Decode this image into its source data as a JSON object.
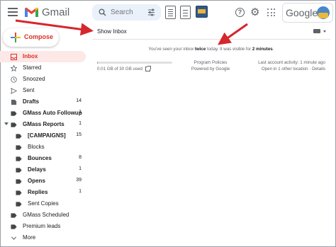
{
  "header": {
    "app_name": "Gmail",
    "search_placeholder": "Search",
    "account_brand": "Google",
    "icons": [
      "menu-icon",
      "gmail-logo",
      "search-icon",
      "filter-icon",
      "extension-icon",
      "extension-icon",
      "extension-icon",
      "help-icon",
      "gear-icon",
      "apps-icon",
      "avatar"
    ]
  },
  "compose": {
    "label": "Compose"
  },
  "sidebar": {
    "items": [
      {
        "label": "Inbox",
        "count": "",
        "icon": "inbox-icon",
        "active": true
      },
      {
        "label": "Starred",
        "count": "",
        "icon": "star-icon"
      },
      {
        "label": "Snoozed",
        "count": "",
        "icon": "clock-icon"
      },
      {
        "label": "Sent",
        "count": "",
        "icon": "send-icon"
      },
      {
        "label": "Drafts",
        "count": "14",
        "icon": "draft-icon"
      },
      {
        "label": "GMass Auto Followup",
        "count": "1",
        "icon": "label-icon"
      },
      {
        "label": "GMass Reports",
        "count": "1",
        "icon": "label-icon",
        "expanded": true
      },
      {
        "label": "[CAMPAIGNS]",
        "count": "15",
        "icon": "label-icon"
      },
      {
        "label": "Blocks",
        "count": "",
        "icon": "label-icon"
      },
      {
        "label": "Bounces",
        "count": "8",
        "icon": "label-icon"
      },
      {
        "label": "Delays",
        "count": "1",
        "icon": "label-icon"
      },
      {
        "label": "Opens",
        "count": "39",
        "icon": "label-icon"
      },
      {
        "label": "Replies",
        "count": "1",
        "icon": "label-icon"
      },
      {
        "label": "Sent Copies",
        "count": "",
        "icon": "label-icon"
      },
      {
        "label": "GMass Scheduled",
        "count": "",
        "icon": "label-icon"
      },
      {
        "label": "Premium leads",
        "count": "",
        "icon": "label-icon"
      },
      {
        "label": "More",
        "count": "",
        "icon": "chevron-down-icon"
      }
    ]
  },
  "main": {
    "show_inbox": "Show Inbox",
    "notice_prefix": "You've seen your inbox ",
    "notice_bold1": "twice",
    "notice_mid": " today. It was visible for ",
    "notice_bold2": "2 minutes",
    "notice_suffix": ".",
    "storage_text": "0.01 GB of 30 GB used",
    "storage_fraction": 0.0003,
    "program_policies": "Program Policies",
    "powered_by": "Powered by Google",
    "last_activity": "Last account activity: 1 minute ago",
    "open_elsewhere": "Open in 1 other location · Details"
  },
  "colors": {
    "accent_red": "#d93025",
    "arrow_red": "#d6262e",
    "active_bg": "#fce8e6",
    "search_bg": "#eaf1fb"
  }
}
